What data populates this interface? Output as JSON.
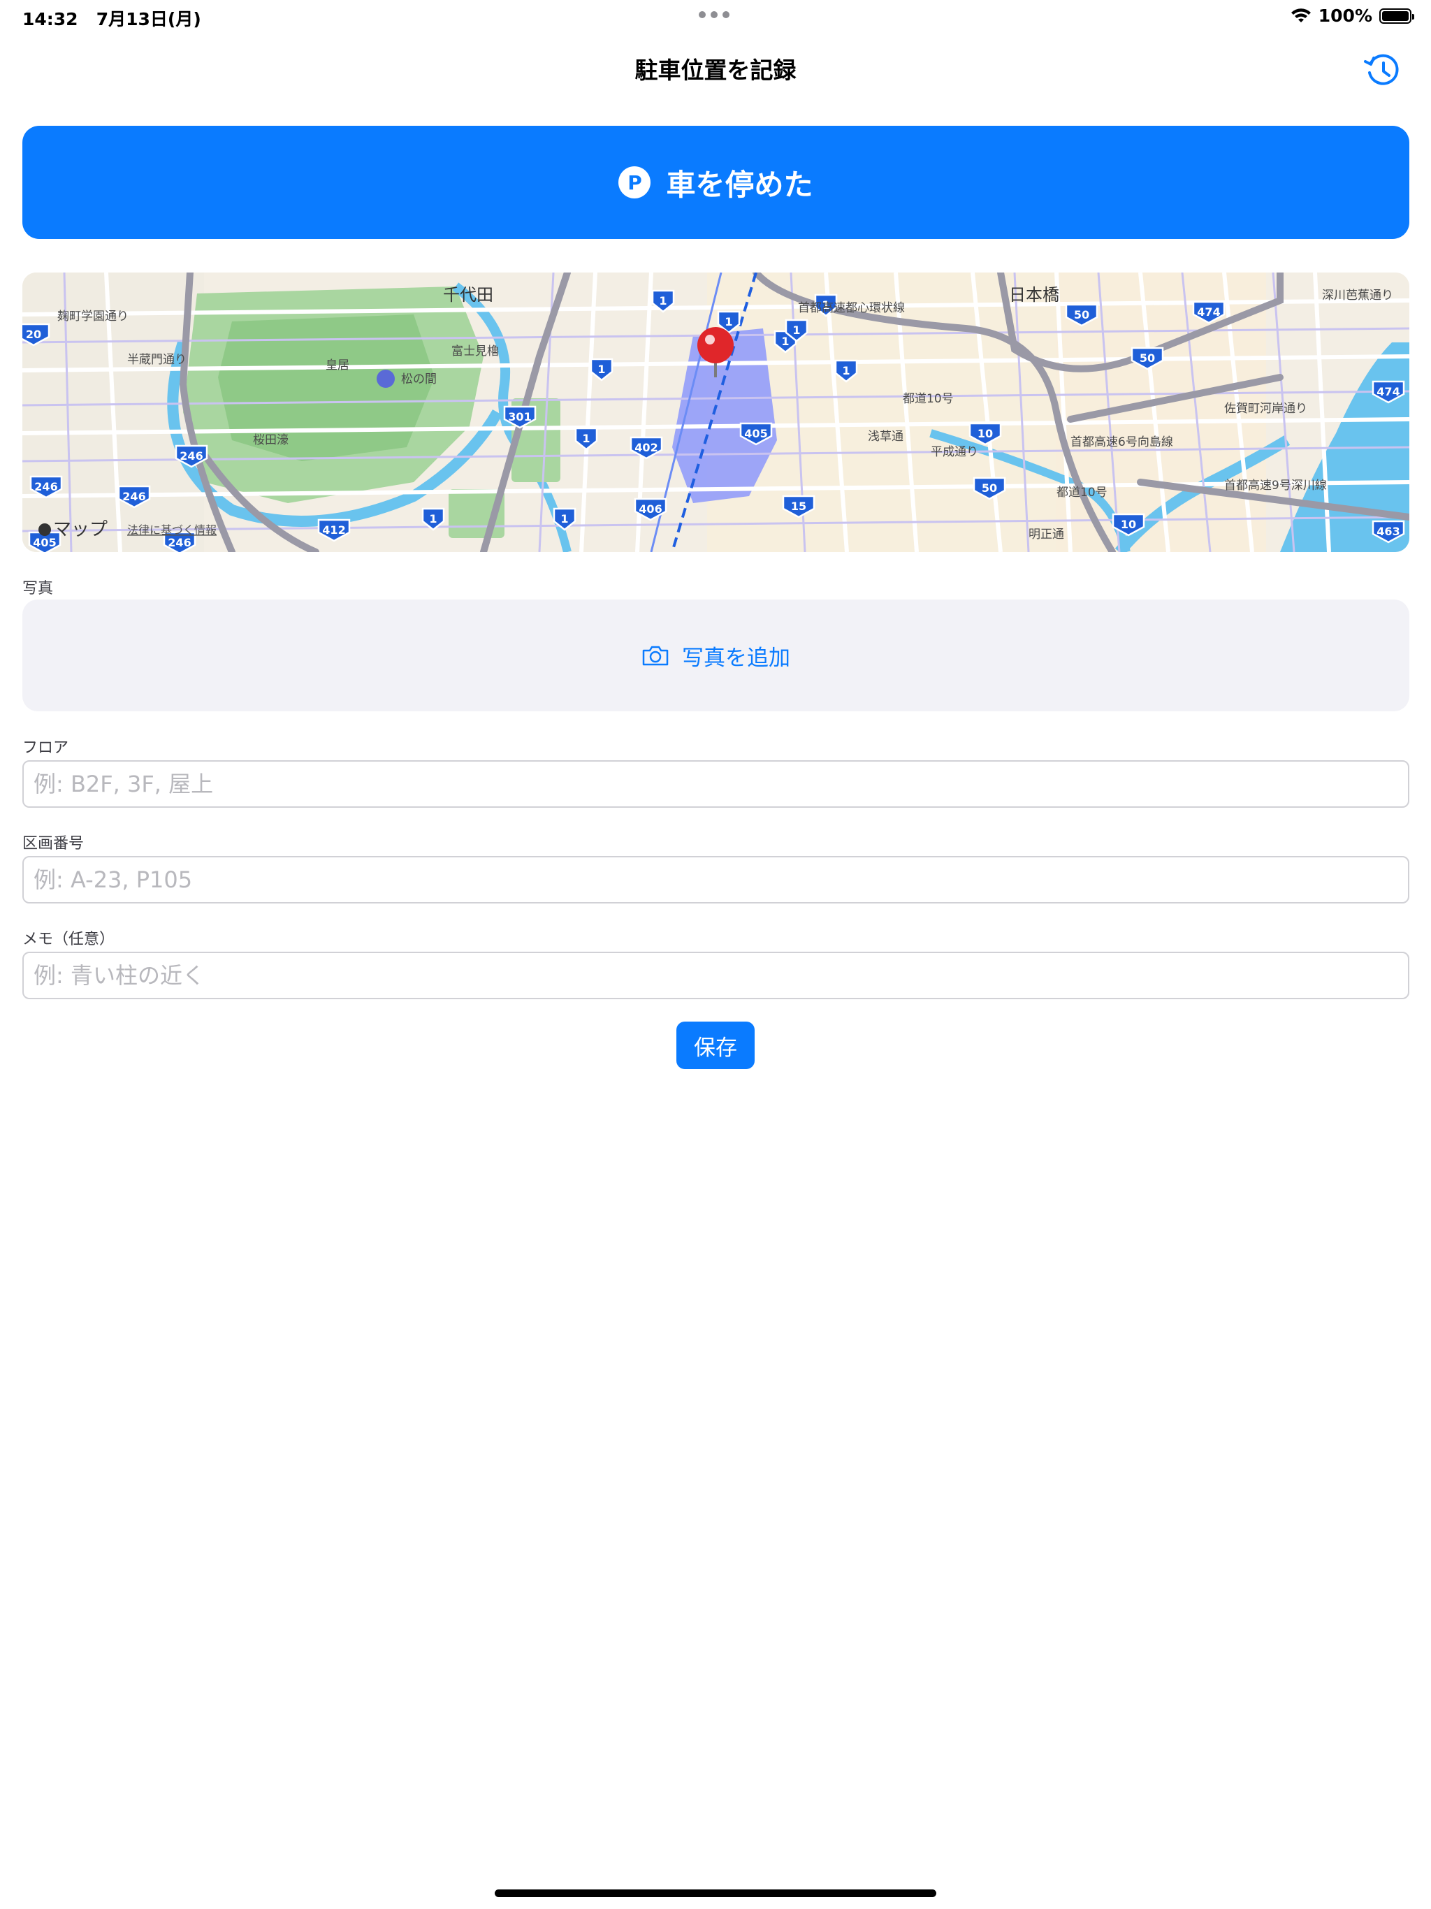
{
  "status_bar": {
    "time": "14:32",
    "date": "7月13日(月)",
    "battery": "100%"
  },
  "nav": {
    "title": "駐車位置を記録",
    "history_icon": "clock-arrow-icon"
  },
  "park_button": {
    "label": "車を停めた",
    "icon_letter": "P"
  },
  "map": {
    "attribution": "マップ",
    "legal": "法律に基づく情報",
    "labels": {
      "chiyoda": "千代田",
      "nihonbashi": "日本橋",
      "koukyo": "皇居",
      "matsunoma": "松の間",
      "fujimi": "富士見櫓",
      "sakuradabori": "桜田濠",
      "kojimachi": "麹町学園通り",
      "hanzomon": "半蔵門通り",
      "shutoko_loop": "首都高速都心環状線",
      "shutoko_6": "首都高速6号向島線",
      "shutoko_9": "首都高速9号深川線",
      "toto10a": "都道10号",
      "toto10b": "都道10号",
      "heisei": "平成通り",
      "kyobashi": "浅草通",
      "fukagawa": "深川芭蕉通り",
      "sakaigawa": "佐賀町河岸通り",
      "meisho": "明正通"
    },
    "shields": [
      "20",
      "246",
      "246",
      "246",
      "405",
      "246",
      "412",
      "1",
      "1",
      "1",
      "1",
      "1",
      "1",
      "1",
      "301",
      "402",
      "406",
      "405",
      "1",
      "15",
      "10",
      "50",
      "10",
      "50",
      "474",
      "474",
      "463",
      "1",
      "50",
      "1"
    ]
  },
  "photo": {
    "section_label": "写真",
    "button_label": "写真を追加"
  },
  "floor": {
    "label": "フロア",
    "placeholder": "例: B2F, 3F, 屋上",
    "value": ""
  },
  "section_number": {
    "label": "区画番号",
    "placeholder": "例: A-23, P105",
    "value": ""
  },
  "memo": {
    "label": "メモ（任意）",
    "placeholder": "例: 青い柱の近く",
    "value": ""
  },
  "save_button": {
    "label": "保存"
  },
  "colors": {
    "accent": "#0a7bff",
    "field_border": "#d1d1d6",
    "photo_bg": "#f2f2f7"
  }
}
